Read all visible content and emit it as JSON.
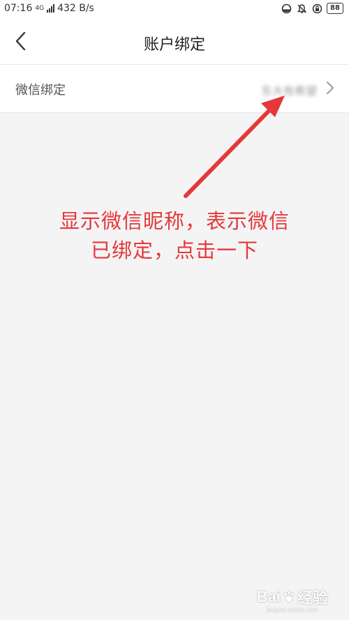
{
  "status_bar": {
    "time": "07:16",
    "network": "4G",
    "speed": "432 B/s",
    "battery": "88"
  },
  "header": {
    "title": "账户绑定"
  },
  "wechat_row": {
    "label": "微信绑定",
    "value": "东大有希望"
  },
  "annotation": {
    "line1": "显示微信昵称，表示微信",
    "line2": "已绑定，点击一下",
    "color": "#e6383a"
  },
  "watermark": {
    "brand": "Bai",
    "brand_suffix": "经验",
    "url": "jingyan.baidu.com"
  }
}
